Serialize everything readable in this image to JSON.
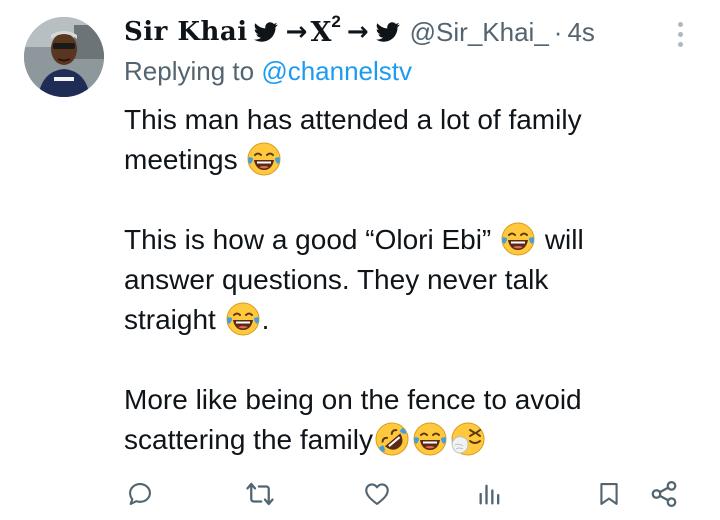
{
  "tweet": {
    "display_name": "Sir Khai",
    "name_arrow_1": "→",
    "name_x": "X",
    "name_x_sup": "2",
    "name_arrow_2": "→",
    "handle": "@Sir_Khai_",
    "separator": "·",
    "time": "4s",
    "replying_prefix": "Replying to",
    "replying_to": "@channelstv",
    "body": {
      "p1_line1": "This man has attended a lot of family",
      "p1_line2": "meetings",
      "p2_line1a": "This is how a good “Olori Ebi”",
      "p2_line1b": " will",
      "p2_line2": "answer questions. They never talk",
      "p2_line3": "straight",
      "p2_line3_end": ".",
      "p3_line1": "More like being on the fence to avoid",
      "p3_line2": "scattering the family"
    }
  },
  "icons": {
    "name_bird_1": "bird-icon",
    "name_bird_2": "bird-icon",
    "more": "more-vertical-icon",
    "emoji_tears": "face-with-tears-of-joy-emoji",
    "emoji_rofl": "rolling-on-floor-laughing-emoji",
    "emoji_sneeze": "sneezing-face-emoji",
    "reply": "reply-icon",
    "retweet": "retweet-icon",
    "like": "heart-icon",
    "views": "views-icon",
    "bookmark": "bookmark-icon",
    "share": "share-icon"
  },
  "colors": {
    "text": "#0f1419",
    "secondary": "#536471",
    "link": "#1d9bf0",
    "emoji_face": "#ffc83d",
    "emoji_tears": "#3aa0e8"
  }
}
